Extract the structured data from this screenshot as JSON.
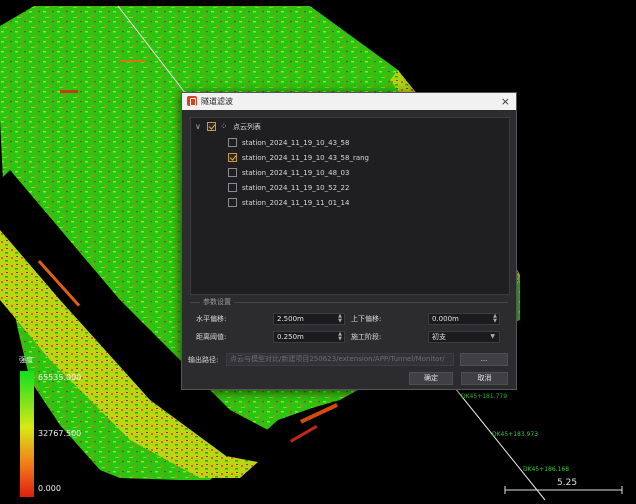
{
  "dialog": {
    "title": "隧道滤波",
    "close": "×",
    "tree": {
      "root_label": "点云列表",
      "root_checked": true,
      "items": [
        {
          "label": "station_2024_11_19_10_43_58",
          "checked": false
        },
        {
          "label": "station_2024_11_19_10_43_58_rang",
          "checked": true
        },
        {
          "label": "station_2024_11_19_10_48_03",
          "checked": false
        },
        {
          "label": "station_2024_11_19_10_52_22",
          "checked": false
        },
        {
          "label": "station_2024_11_19_11_01_14",
          "checked": false
        }
      ]
    },
    "params": {
      "group_title": "参数设置",
      "horizontal_offset_label": "水平偏移:",
      "horizontal_offset_value": "2.500m",
      "vertical_offset_label": "上下偏移:",
      "vertical_offset_value": "0.000m",
      "distance_threshold_label": "距离阈值:",
      "distance_threshold_value": "0.250m",
      "construction_stage_label": "施工阶段:",
      "construction_stage_value": "初支"
    },
    "output": {
      "label": "输出路径:",
      "path": "点云与模型对比/新建项目250623/extension/APP/Tunnel/Monitor/",
      "browse": "..."
    },
    "ok_label": "确定",
    "cancel_label": "取消"
  },
  "legend": {
    "title": "强度",
    "max": "65535.000",
    "mid": "32767.500",
    "min": "0.000",
    "colors": [
      "#11e020",
      "#d8e814",
      "#f07818",
      "#e01e12"
    ]
  },
  "stations": [
    "DK45+181.779",
    "DK45+183.973",
    "DK45+186.168"
  ],
  "scale_value": "5.25"
}
